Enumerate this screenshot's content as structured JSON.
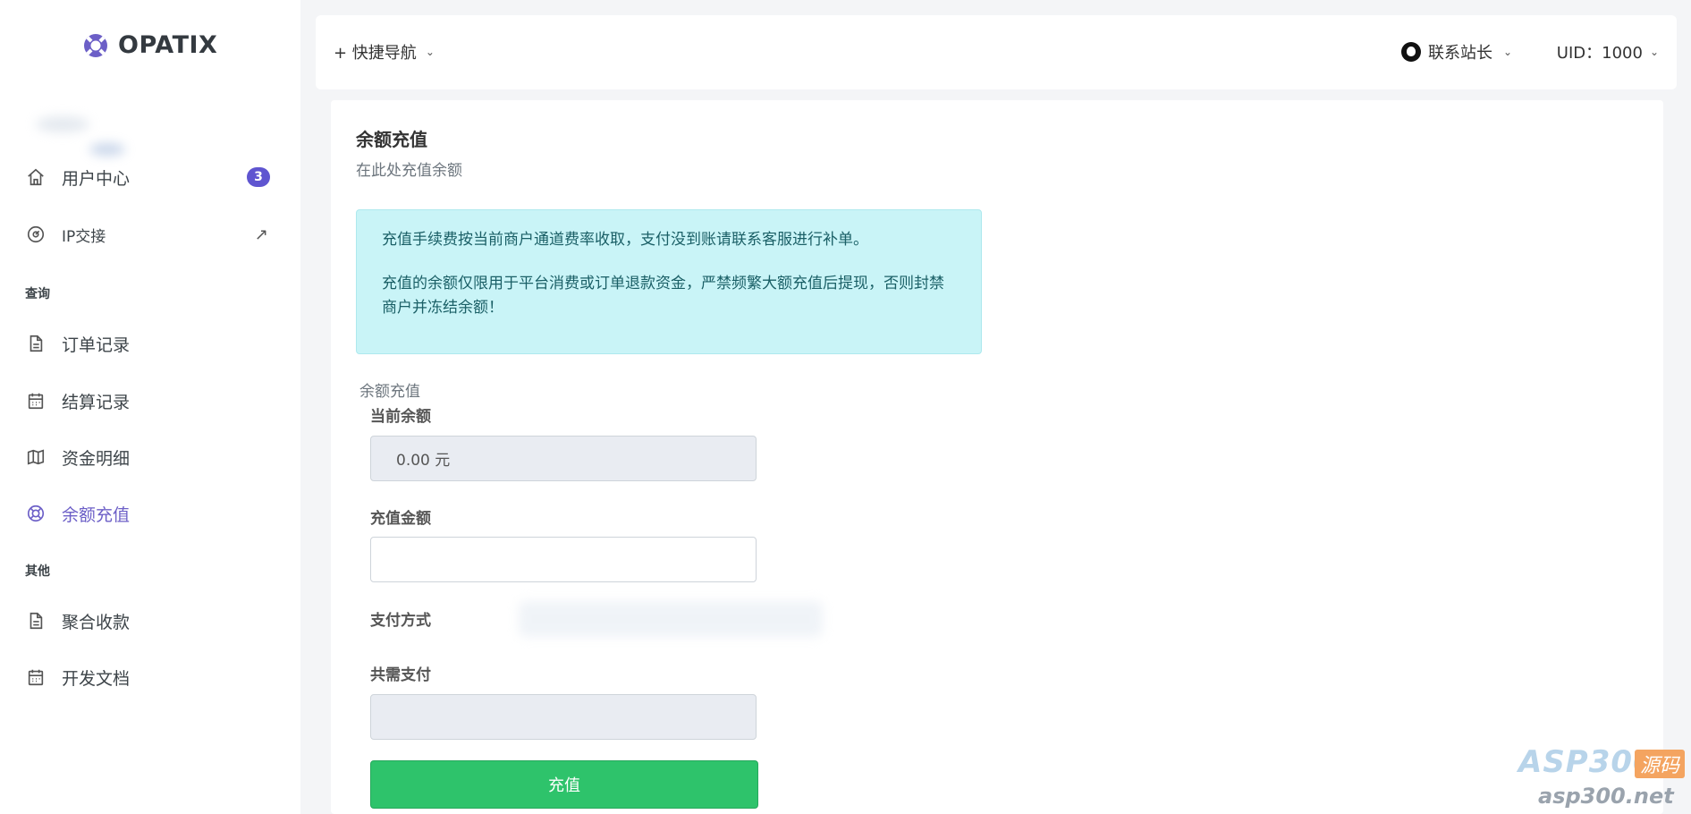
{
  "brand": {
    "name": "OPATIX"
  },
  "sidebar": {
    "items": [
      {
        "label": "用户中心",
        "badge": "3",
        "icon": "home-icon"
      },
      {
        "label": "IP交接",
        "icon": "gauge-icon",
        "right_mark": "↗"
      }
    ],
    "sections": [
      {
        "heading": "查询",
        "items": [
          {
            "label": "订单记录",
            "icon": "file-icon"
          },
          {
            "label": "结算记录",
            "icon": "calendar-icon"
          },
          {
            "label": "资金明细",
            "icon": "map-icon"
          },
          {
            "label": "余额充值",
            "icon": "lifebuoy-icon",
            "active": true
          }
        ]
      },
      {
        "heading": "其他",
        "items": [
          {
            "label": "聚合收款",
            "icon": "file-icon"
          },
          {
            "label": "开发文档",
            "icon": "calendar-icon"
          }
        ]
      }
    ]
  },
  "header": {
    "quick_nav": "+ 快捷导航",
    "contact": "联系站长",
    "uid": "UID：1000"
  },
  "main": {
    "title": "余额充值",
    "subtitle": "在此处充值余额",
    "notice": [
      "充值手续费按当前商户通道费率收取，支付没到账请联系客服进行补单。",
      "充值的余额仅限用于平台消费或订单退款资金，严禁频繁大额充值后提现，否则封禁商户并冻结余额！"
    ],
    "legend": "余额充值",
    "form": {
      "balance_label": "当前余额",
      "balance_value": "0.00 元",
      "amount_label": "充值金额",
      "amount_value": "",
      "payment_label": "支付方式",
      "total_label": "共需支付",
      "total_value": "",
      "submit_label": "充值"
    }
  },
  "watermark": {
    "main": "ASP300",
    "tag": "源码",
    "url": "asp300.net"
  },
  "colors": {
    "accent": "#6c5fc7",
    "badge": "#5f55d0",
    "notice_bg": "#c9f4f7",
    "submit": "#2ec36b"
  }
}
